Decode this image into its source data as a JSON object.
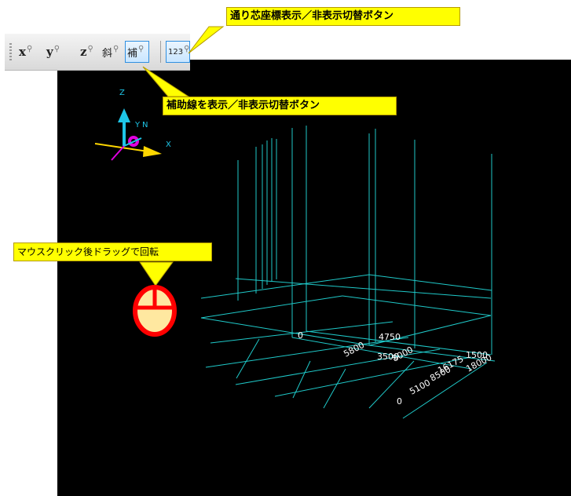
{
  "toolbar": {
    "buttons": [
      {
        "label": "x"
      },
      {
        "label": "y"
      },
      {
        "label": "z"
      },
      {
        "label": "斜"
      },
      {
        "label": "補"
      },
      {
        "label": "123"
      }
    ]
  },
  "callouts": {
    "grid_toggle": "通り芯座標表示／非表示切替ボタン",
    "aux_toggle": "補助線を表示／非表示切替ボタン",
    "rotate_hint": "マウスクリック後ドラッグで回転"
  },
  "axis_labels": {
    "x": "X",
    "y": "Y",
    "n": "N",
    "z": "Z"
  },
  "grid_labels": [
    {
      "text": "0"
    },
    {
      "text": "4750"
    },
    {
      "text": "5800"
    },
    {
      "text": "3500"
    },
    {
      "text": "8000"
    },
    {
      "text": "1500"
    },
    {
      "text": "16175"
    },
    {
      "text": "18000"
    },
    {
      "text": "8500"
    },
    {
      "text": "5100"
    },
    {
      "text": "0"
    }
  ],
  "colors": {
    "grid": "#1fc9c9",
    "callout": "#ffff00",
    "background": "#000000",
    "mouse_red": "#ff0000",
    "mouse_fill": "#ffe8a0"
  }
}
